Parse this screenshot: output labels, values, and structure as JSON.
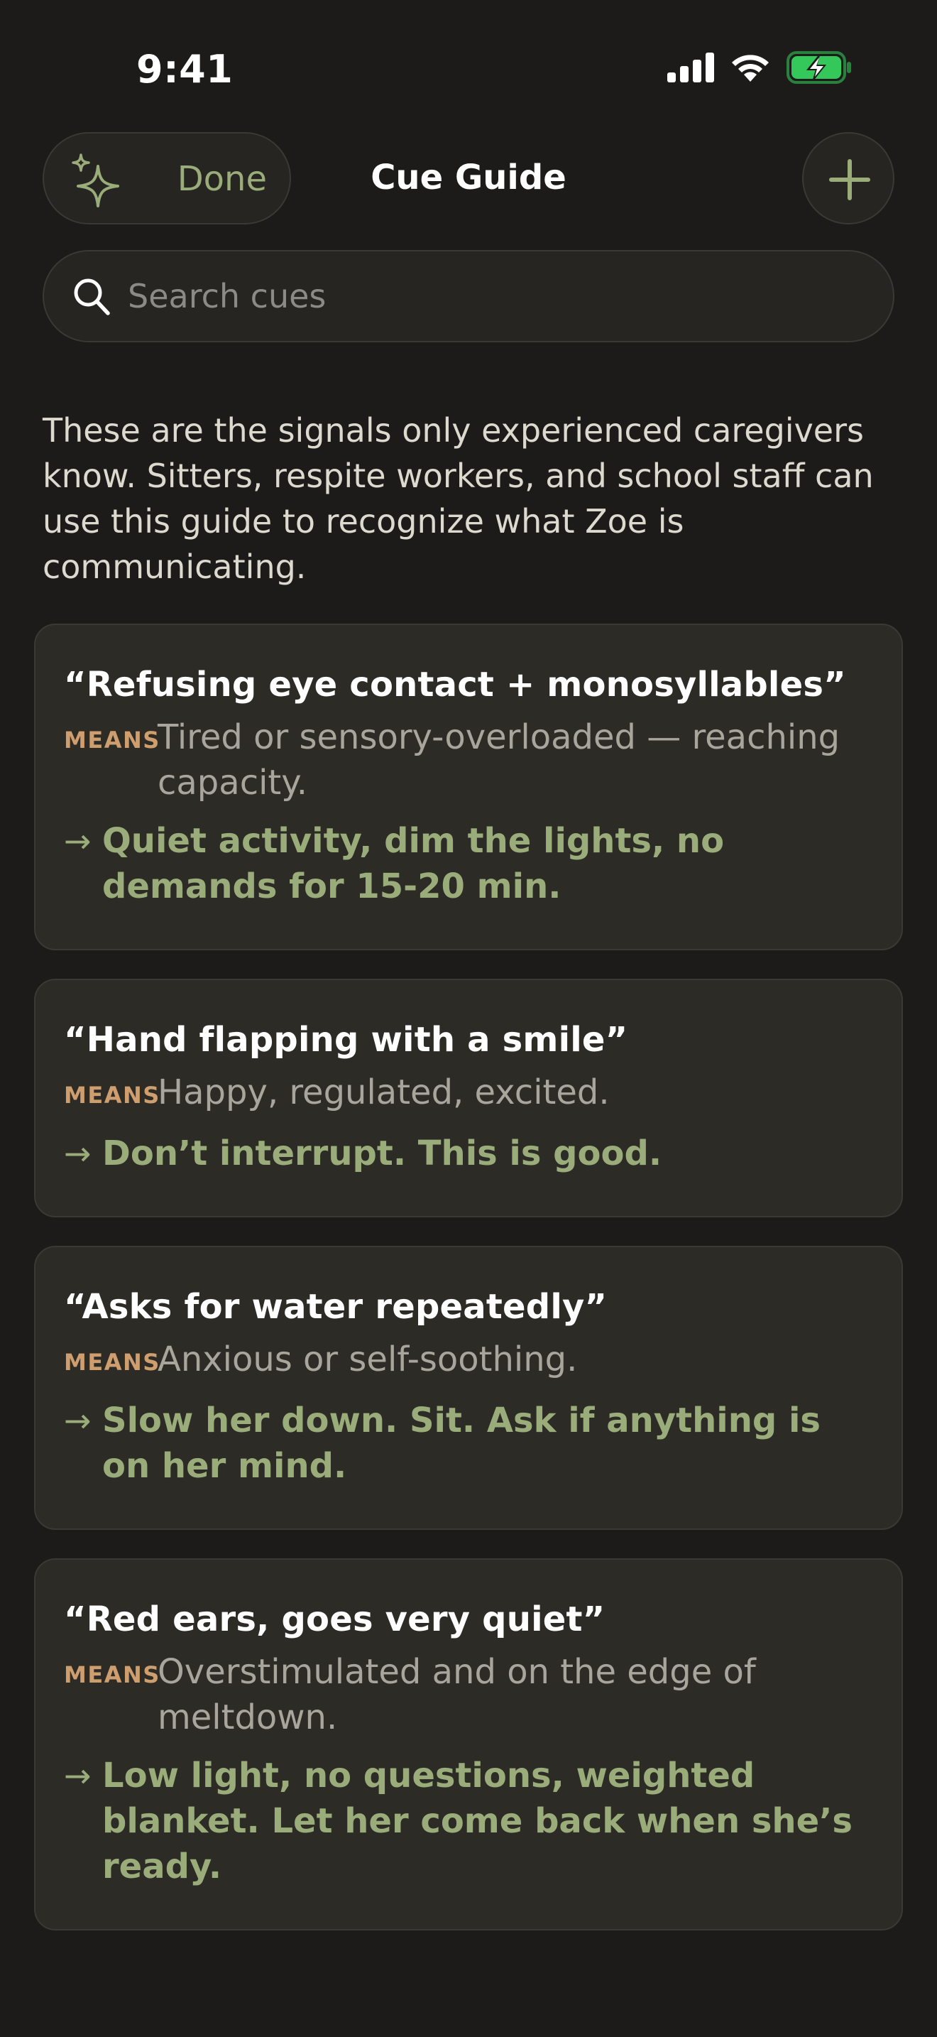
{
  "status_bar": {
    "time": "9:41"
  },
  "header": {
    "done_label": "Done",
    "title": "Cue Guide"
  },
  "search": {
    "placeholder": "Search cues"
  },
  "intro": "These are the signals only experienced caregivers know. Sitters, respite workers, and school staff can use this guide to recognize what Zoe is communicating.",
  "means_label": "MEANS",
  "cards": [
    {
      "title": "“Refusing eye contact + monosyllables”",
      "means": "Tired or sensory-overloaded — reaching capacity.",
      "action": "Quiet activity, dim the lights, no demands for 15-20 min."
    },
    {
      "title": "“Hand flapping with a smile”",
      "means": "Happy, regulated, excited.",
      "action": "Don’t interrupt. This is good."
    },
    {
      "title": "“Asks for water repeatedly”",
      "means": "Anxious or self-soothing.",
      "action": "Slow her down. Sit. Ask if anything is on her mind."
    },
    {
      "title": "“Red ears, goes very quiet”",
      "means": "Overstimulated and on the edge of meltdown.",
      "action": "Low light, no questions, weighted blanket. Let her come back when she’s ready."
    }
  ],
  "icons": {
    "sparkle": "sparkle-icon",
    "plus": "plus-icon",
    "search": "search-icon",
    "arrow": "arrow-right-icon"
  },
  "colors": {
    "background": "#1c1b19",
    "card": "#2c2b26",
    "accent_green": "#9aac7a",
    "means_orange": "#cf9e6e",
    "battery_green": "#34c759"
  }
}
